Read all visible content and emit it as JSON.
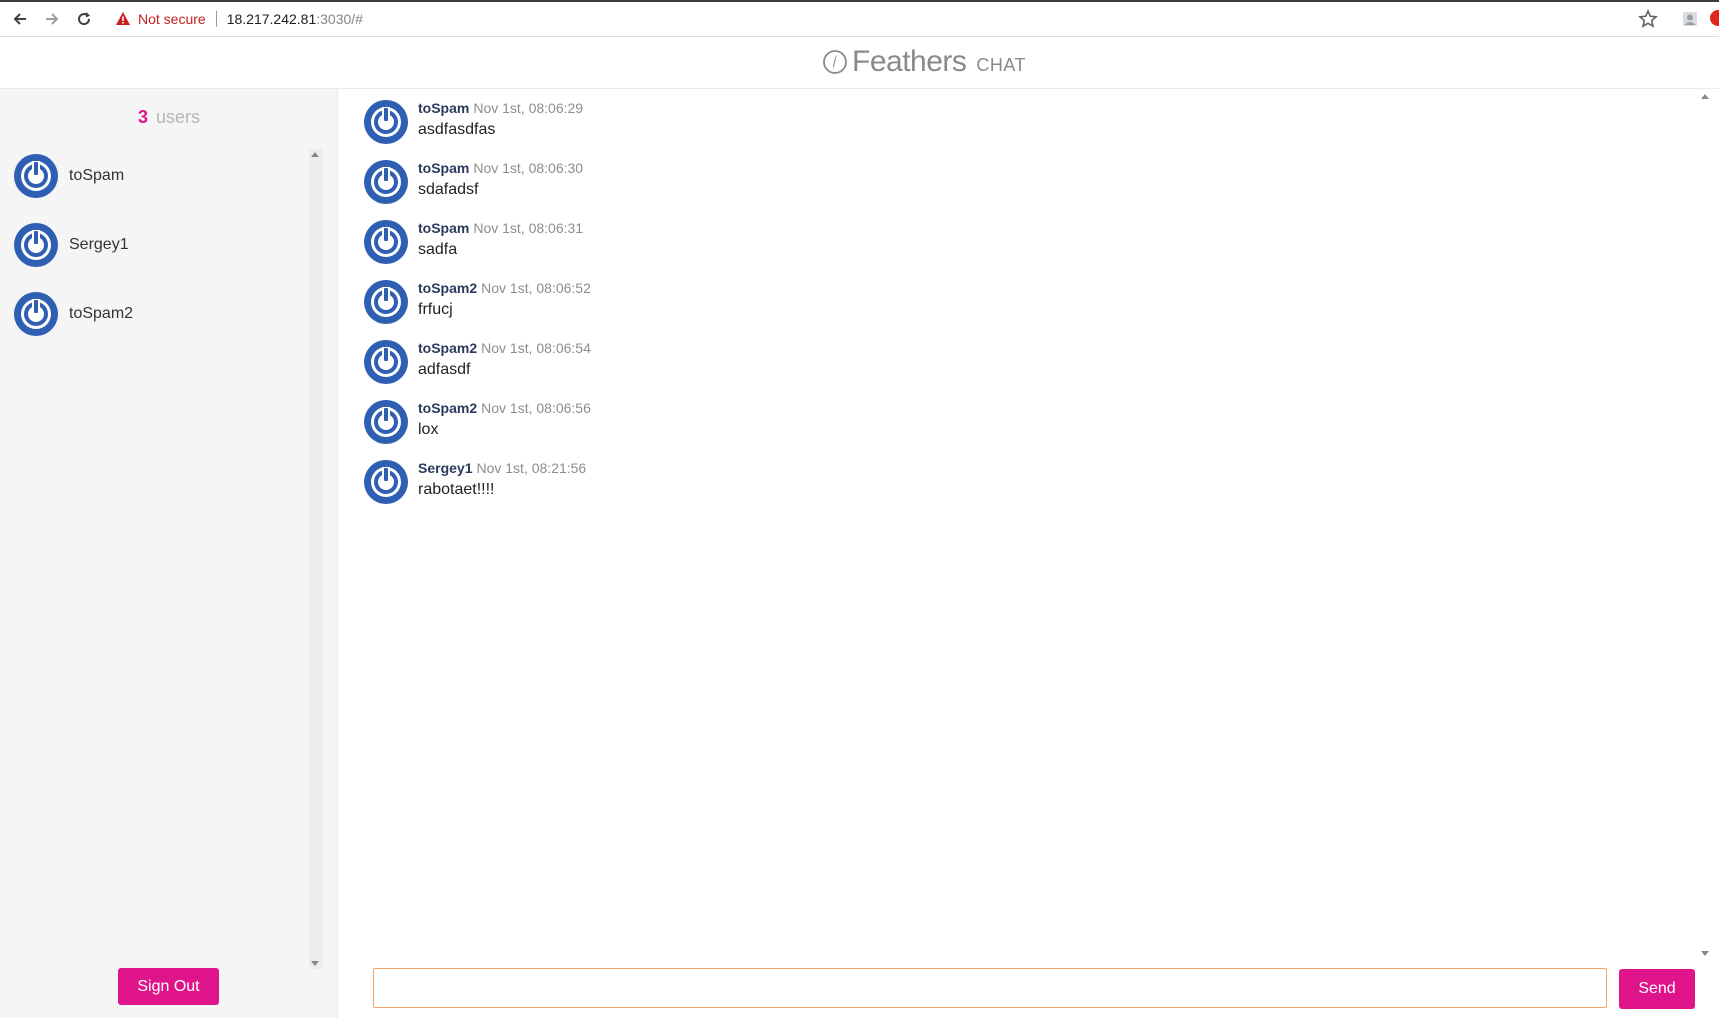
{
  "browser": {
    "security_label": "Not secure",
    "url_host": "18.217.242.81",
    "url_rest": ":3030/#"
  },
  "header": {
    "brand_name": "Feathers",
    "brand_suffix": "CHAT"
  },
  "sidebar": {
    "user_count": "3",
    "user_count_label": "users",
    "users": [
      {
        "name": "toSpam"
      },
      {
        "name": "Sergey1"
      },
      {
        "name": "toSpam2"
      }
    ],
    "signout_label": "Sign Out"
  },
  "messages": [
    {
      "author": "toSpam",
      "time": "Nov 1st, 08:06:29",
      "text": "asdfasdfas"
    },
    {
      "author": "toSpam",
      "time": "Nov 1st, 08:06:30",
      "text": "sdafadsf"
    },
    {
      "author": "toSpam",
      "time": "Nov 1st, 08:06:31",
      "text": "sadfa"
    },
    {
      "author": "toSpam2",
      "time": "Nov 1st, 08:06:52",
      "text": "frfucj"
    },
    {
      "author": "toSpam2",
      "time": "Nov 1st, 08:06:54",
      "text": "adfasdf"
    },
    {
      "author": "toSpam2",
      "time": "Nov 1st, 08:06:56",
      "text": "lox"
    },
    {
      "author": "Sergey1",
      "time": "Nov 1st, 08:21:56",
      "text": "rabotaet!!!!"
    }
  ],
  "composer": {
    "value": "",
    "send_label": "Send"
  },
  "colors": {
    "accent": "#e0148a",
    "avatar_blue": "#2f5fb3",
    "input_border": "#f2a36b"
  }
}
